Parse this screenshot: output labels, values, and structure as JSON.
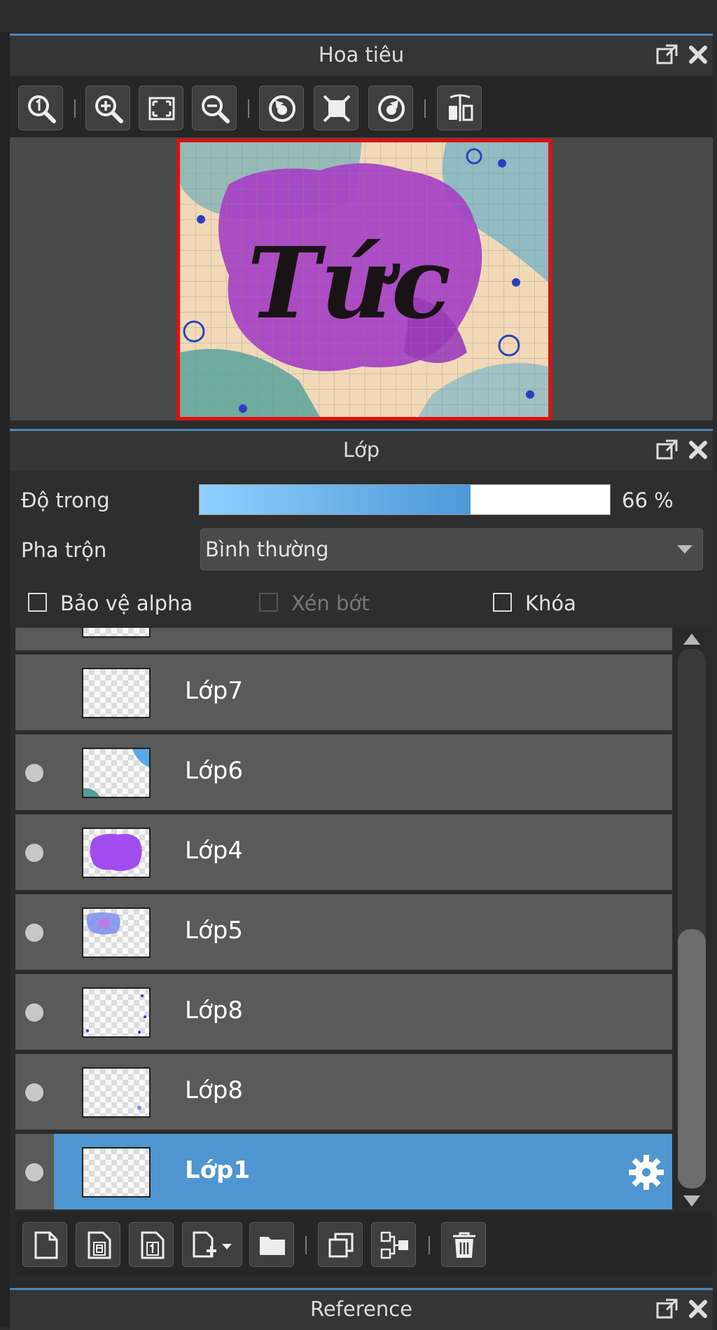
{
  "navigator": {
    "title": "Hoa tiêu",
    "toolbar_icons": [
      "zoom-actual-icon",
      "zoom-in-icon",
      "fit-screen-icon",
      "zoom-out-icon",
      "rotate-left-icon",
      "fit-rotate-icon",
      "rotate-right-icon",
      "flip-horizontal-icon"
    ],
    "preview": {
      "text": "Tức",
      "border_color": "#e01010"
    }
  },
  "layers_panel": {
    "title": "Lớp",
    "opacity": {
      "label": "Độ trong",
      "value_text": "66 %",
      "fraction": 0.66
    },
    "blend": {
      "label": "Pha trộn",
      "selected": "Bình thường"
    },
    "checkboxes": {
      "protect_alpha": "Bảo vệ alpha",
      "clip": "Xén bớt",
      "lock": "Khóa"
    },
    "layers": [
      {
        "name": "Lớp7",
        "visible": false,
        "selected": false
      },
      {
        "name": "Lớp6",
        "visible": true,
        "selected": false
      },
      {
        "name": "Lớp4",
        "visible": true,
        "selected": false
      },
      {
        "name": "Lớp5",
        "visible": true,
        "selected": false
      },
      {
        "name": "Lớp8",
        "visible": true,
        "selected": false
      },
      {
        "name": "Lớp8",
        "visible": true,
        "selected": false
      },
      {
        "name": "Lớp1",
        "visible": true,
        "selected": true
      }
    ],
    "bottom_toolbar_icons": [
      "new-layer-icon",
      "new-8bit-layer-icon",
      "new-1bit-layer-icon",
      "add-layer-menu-icon",
      "folder-icon",
      "duplicate-icon",
      "merge-down-icon",
      "trash-icon"
    ]
  },
  "reference": {
    "title": "Reference"
  },
  "colors": {
    "accent": "#4f95cf",
    "opacity_fill": "#5aaae6"
  }
}
